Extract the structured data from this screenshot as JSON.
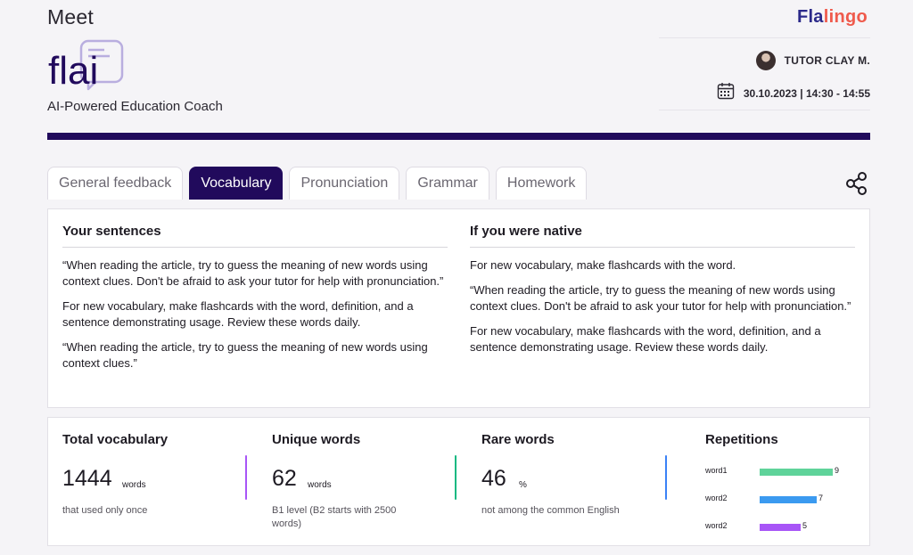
{
  "header": {
    "title": "Meet",
    "tagline": "AI-Powered Education Coach",
    "logo_text": "flai",
    "brand": {
      "part1": "Fla",
      "part2": "lingo"
    },
    "tutor": "TUTOR CLAY M.",
    "datetime": "30.10.2023 | 14:30 - 14:55"
  },
  "tabs": [
    {
      "label": "General feedback",
      "active": false
    },
    {
      "label": "Vocabulary",
      "active": true
    },
    {
      "label": "Pronunciation",
      "active": false
    },
    {
      "label": "Grammar",
      "active": false
    },
    {
      "label": "Homework",
      "active": false
    }
  ],
  "sentences": {
    "left_title": "Your sentences",
    "left": [
      "“When reading the article, try to guess the meaning of new words using context clues. Don't be afraid to ask your tutor for help with pronunciation.”",
      " For new vocabulary, make flashcards with the word, definition, and a sentence demonstrating usage. Review these words daily.",
      "“When reading the article, try to guess the meaning of new words using context clues.”"
    ],
    "right_title": "If you were native",
    "right": [
      " For new vocabulary, make flashcards with the word.",
      "“When reading the article, try to guess the meaning of new words using context clues. Don't be afraid to ask your tutor for help with pronunciation.”",
      " For new vocabulary, make flashcards with the word, definition, and a sentence demonstrating usage. Review these words daily."
    ]
  },
  "stats": {
    "total": {
      "title": "Total vocabulary",
      "value": "1444",
      "unit": "words",
      "note": "that used only once",
      "color": "#a855f7"
    },
    "unique": {
      "title": "Unique words",
      "value": "62",
      "unit": "words",
      "note": "B1 level (B2 starts with 2500 words)",
      "color": "#10b981"
    },
    "rare": {
      "title": "Rare words",
      "value": "46",
      "unit": "%",
      "note": "not among the common English",
      "color": "#3b82f6"
    }
  },
  "repetitions": {
    "title": "Repetitions",
    "items": [
      {
        "label": "word1",
        "value": 9,
        "color": "#5fd39a"
      },
      {
        "label": "word2",
        "value": 7,
        "color": "#3b9af0"
      },
      {
        "label": "word2",
        "value": 5,
        "color": "#a855f7"
      }
    ]
  }
}
